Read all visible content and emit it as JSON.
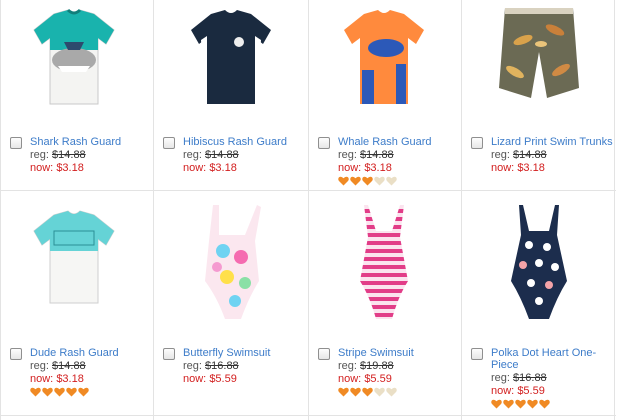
{
  "products": [
    {
      "name": "Shark Rash Guard",
      "reg_label": "reg:",
      "reg_price": "$14.88",
      "now_label": "now:",
      "now_price": "$3.18",
      "rating": 0
    },
    {
      "name": "Hibiscus Rash Guard",
      "reg_label": "reg:",
      "reg_price": "$14.88",
      "now_label": "now:",
      "now_price": "$3.18",
      "rating": 0
    },
    {
      "name": "Whale Rash Guard",
      "reg_label": "reg:",
      "reg_price": "$14.88",
      "now_label": "now:",
      "now_price": "$3.18",
      "rating": 3
    },
    {
      "name": "Lizard Print Swim Trunks",
      "reg_label": "reg:",
      "reg_price": "$14.88",
      "now_label": "now:",
      "now_price": "$3.18",
      "rating": 0
    },
    {
      "name": "Dude Rash Guard",
      "reg_label": "reg:",
      "reg_price": "$14.88",
      "now_label": "now:",
      "now_price": "$3.18",
      "rating": 5
    },
    {
      "name": "Butterfly Swimsuit",
      "reg_label": "reg:",
      "reg_price": "$16.88",
      "now_label": "now:",
      "now_price": "$5.59",
      "rating": 0
    },
    {
      "name": "Stripe Swimsuit",
      "reg_label": "reg:",
      "reg_price": "$19.88",
      "now_label": "now:",
      "now_price": "$5.59",
      "rating": 3
    },
    {
      "name": "Polka Dot Heart One-Piece",
      "reg_label": "reg:",
      "reg_price": "$16.88",
      "now_label": "now:",
      "now_price": "$5.59",
      "rating": 5
    }
  ],
  "rating_max": 5,
  "colors": {
    "link": "#3d7cc9",
    "sale_price": "#d21e1e",
    "heart_on": "#f08a24",
    "heart_off": "#eadfc6"
  },
  "icons": {
    "heart": "heart-icon",
    "checkbox": "compare-checkbox"
  }
}
